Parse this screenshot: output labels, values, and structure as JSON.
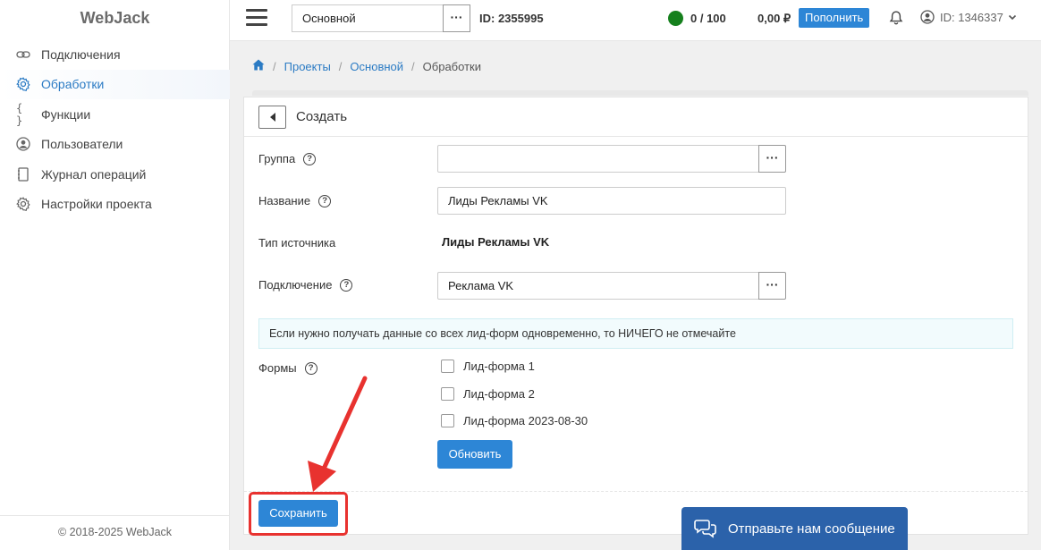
{
  "app": {
    "logo": "WebJack",
    "footer": "© 2018-2025 WebJack"
  },
  "sidebar": {
    "items": [
      {
        "label": "Подключения",
        "icon": "link-icon",
        "active": false
      },
      {
        "label": "Обработки",
        "icon": "gear-icon",
        "active": true
      },
      {
        "label": "Функции",
        "icon": "braces-icon",
        "active": false
      },
      {
        "label": "Пользователи",
        "icon": "user-icon",
        "active": false
      },
      {
        "label": "Журнал операций",
        "icon": "journal-icon",
        "active": false
      },
      {
        "label": "Настройки проекта",
        "icon": "gear-icon",
        "active": false
      }
    ]
  },
  "topbar": {
    "project_value": "Основной",
    "project_dots": "···",
    "project_id": "ID: 2355995",
    "status_color": "#15801d",
    "counter": "0 / 100",
    "balance": "0,00 ₽",
    "topup_label": "Пополнить",
    "user_id": "ID: 1346337"
  },
  "breadcrumb": {
    "items": [
      "Проекты",
      "Основной"
    ],
    "current": "Обработки",
    "sep": "/"
  },
  "card": {
    "title": "Создать",
    "fields": {
      "group_label": "Группа",
      "group_value": "",
      "name_label": "Название",
      "name_value": "Лиды Рекламы VK",
      "source_type_label": "Тип источника",
      "source_type_value": "Лиды Рекламы VK",
      "connection_label": "Подключение",
      "connection_value": "Реклама VK",
      "dots": "···"
    },
    "info": "Если нужно получать данные со всех лид-форм одновременно, то НИЧЕГО не отмечайте",
    "forms_label": "Формы",
    "forms": [
      "Лид-форма 1",
      "Лид-форма 2",
      "Лид-форма 2023-08-30"
    ],
    "update_label": "Обновить",
    "save_label": "Сохранить"
  },
  "chat": {
    "label": "Отправьте нам сообщение"
  },
  "colors": {
    "accent": "#2d86d6",
    "highlight": "#e8322f",
    "chat": "#2b62aa"
  }
}
